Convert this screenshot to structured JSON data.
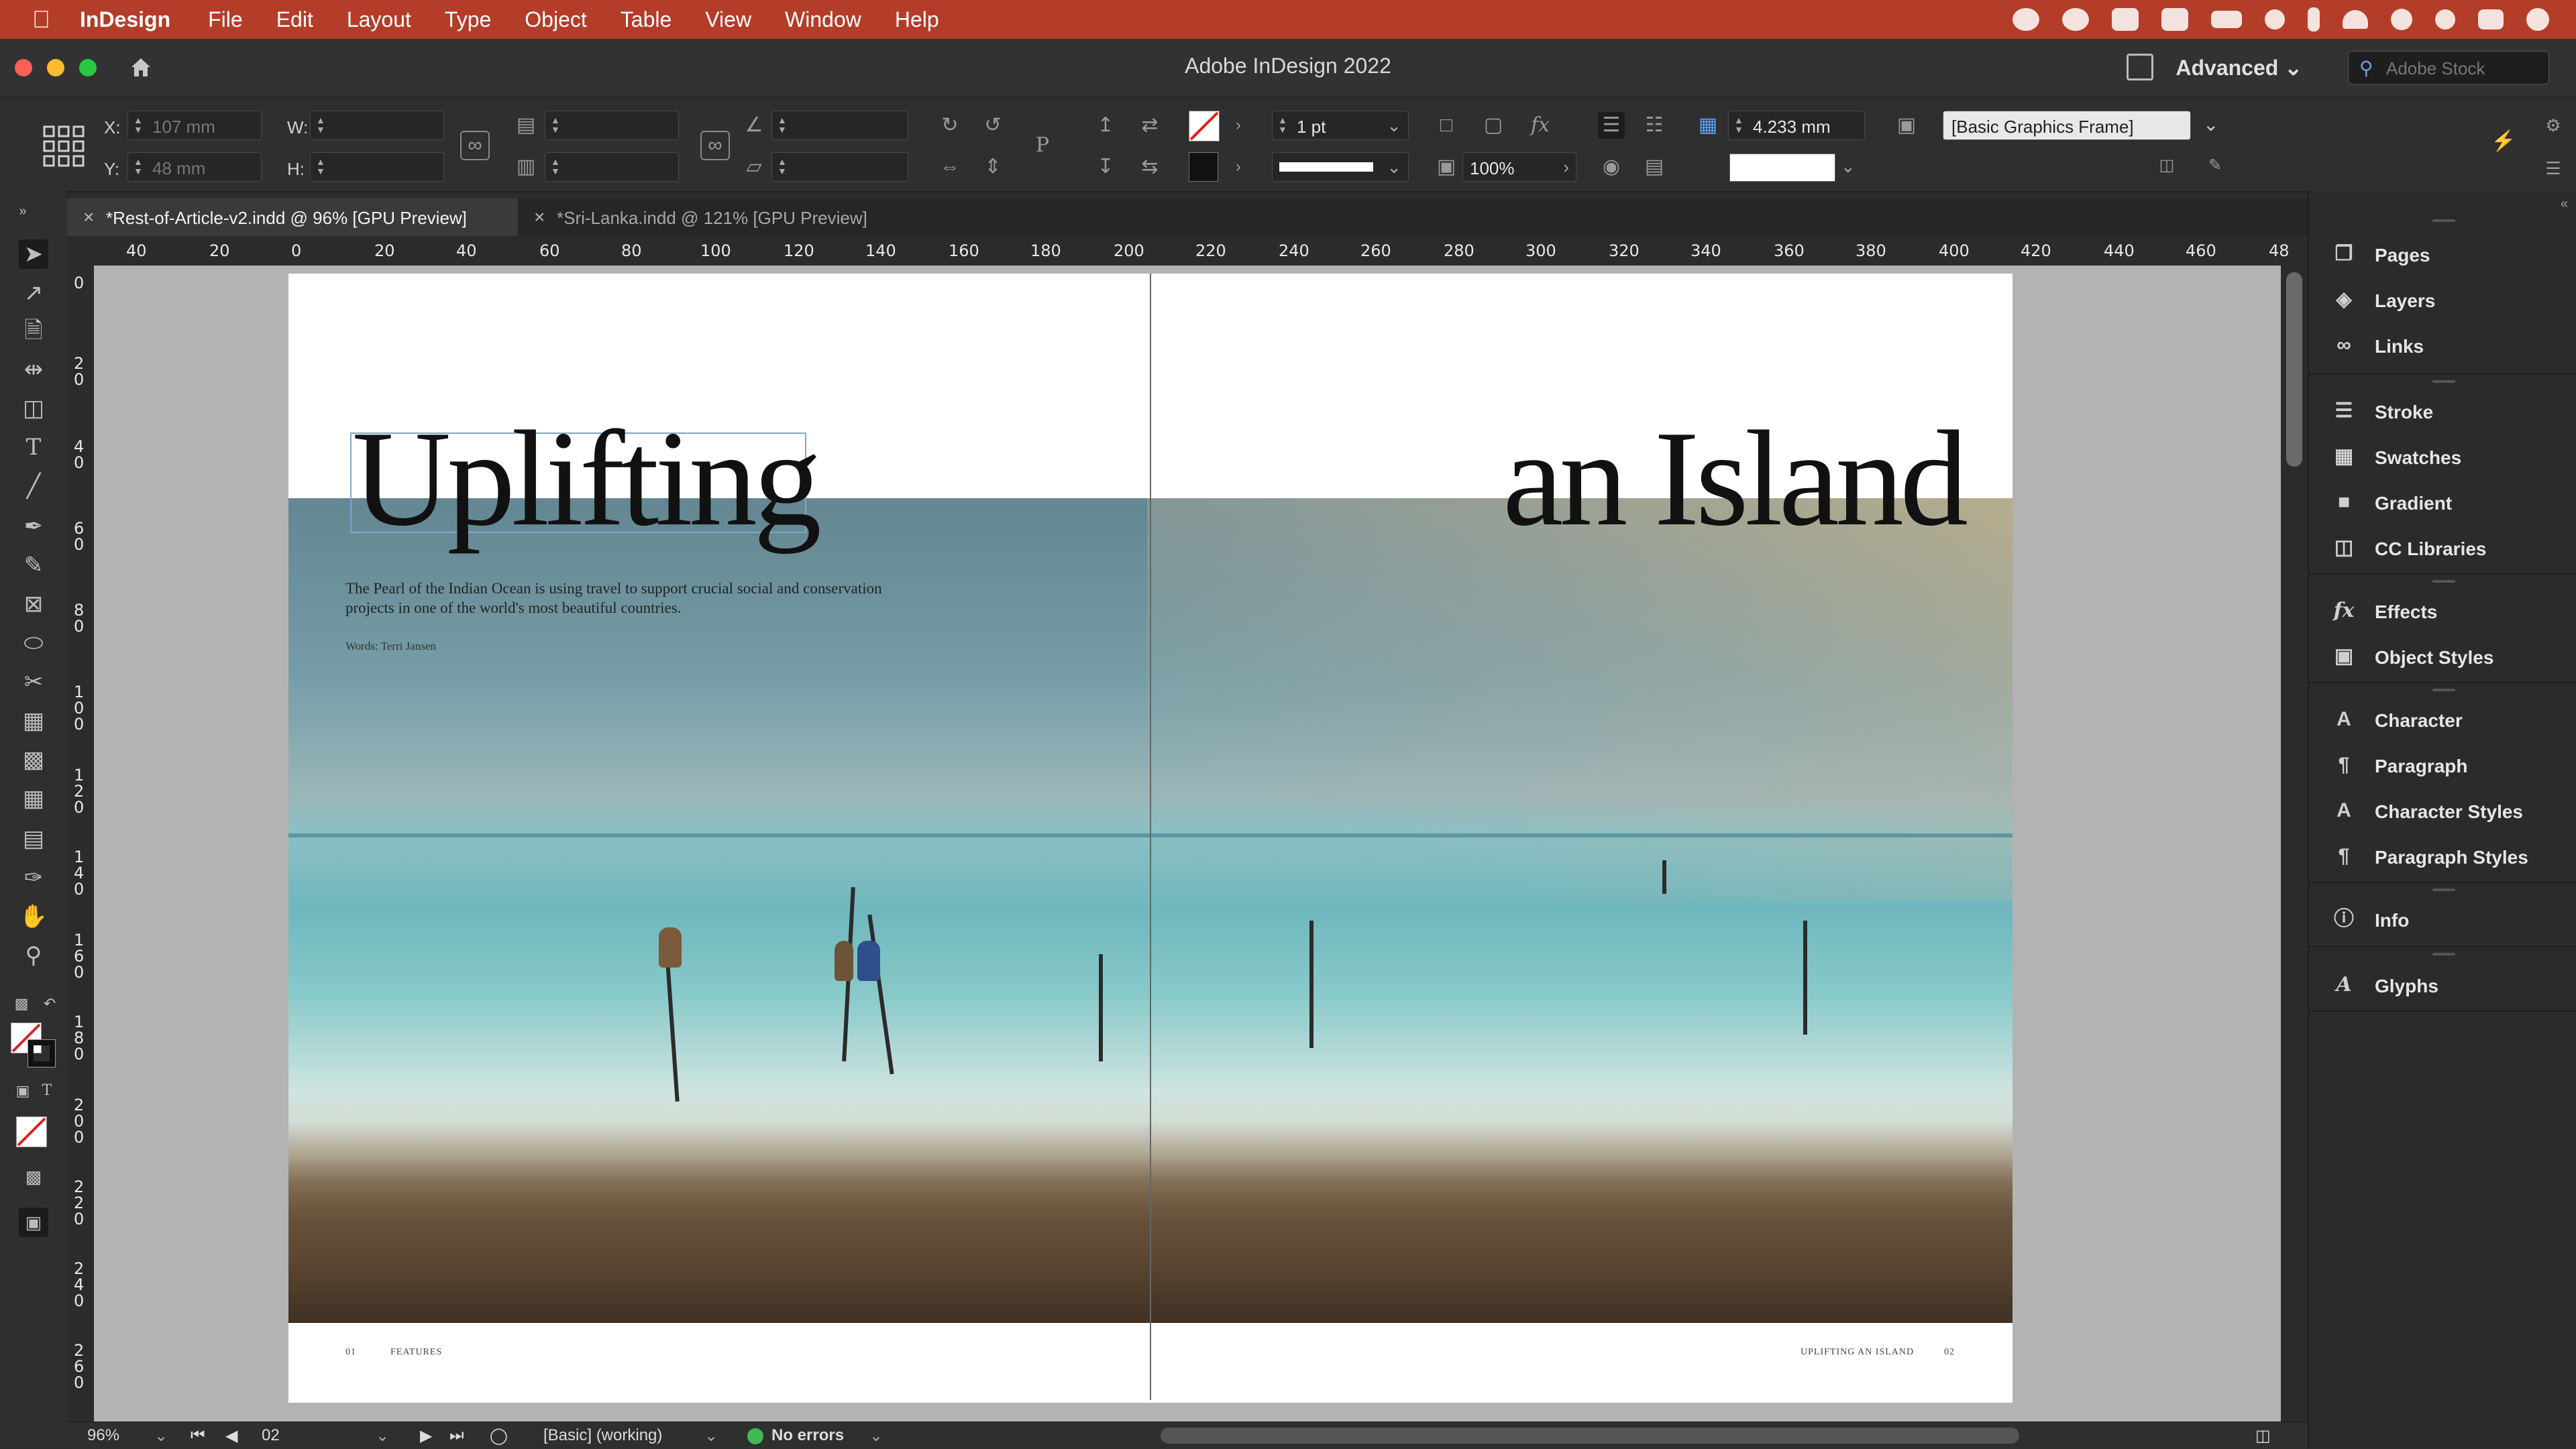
{
  "menubar": {
    "app_name": "InDesign",
    "menus": [
      "File",
      "Edit",
      "Layout",
      "Type",
      "Object",
      "Table",
      "View",
      "Window",
      "Help"
    ],
    "bg_color": "#b33d28",
    "tray_icons": [
      "creative-cloud-icon",
      "sync-icon",
      "dropbox-icon",
      "acrobat-icon",
      "battery-icon",
      "moon-icon",
      "bluetooth-icon",
      "wifi-icon",
      "user-icon",
      "search-icon",
      "control-center-icon",
      "siri-icon"
    ]
  },
  "window": {
    "title": "Adobe InDesign 2022",
    "workspace": "Advanced",
    "stock_search_placeholder": "Adobe Stock"
  },
  "controls": {
    "x_label": "X:",
    "x_value": "107 mm",
    "y_label": "Y:",
    "y_value": "48 mm",
    "w_label": "W:",
    "h_label": "H:",
    "stroke_weight": "1 pt",
    "opacity": "100%",
    "offset": "4.233 mm",
    "object_style": "[Basic Graphics Frame]"
  },
  "tabs": [
    {
      "label": "*Rest-of-Article-v2.indd @ 96% [GPU Preview]",
      "active": true
    },
    {
      "label": "*Sri-Lanka.indd @ 121% [GPU Preview]",
      "active": false
    }
  ],
  "hruler_ticks": [
    "40",
    "20",
    "0",
    "20",
    "40",
    "60",
    "80",
    "100",
    "120",
    "140",
    "160",
    "180",
    "200",
    "220",
    "240",
    "260",
    "280",
    "300",
    "320",
    "340",
    "360",
    "380",
    "400",
    "420",
    "440",
    "460",
    "48"
  ],
  "vruler_ticks": [
    "0",
    "2\n0",
    "4\n0",
    "6\n0",
    "8\n0",
    "1\n0\n0",
    "1\n2\n0",
    "1\n4\n0",
    "1\n6\n0",
    "1\n8\n0",
    "2\n0\n0",
    "2\n2\n0",
    "2\n4\n0",
    "2\n6\n0"
  ],
  "spread": {
    "headline_left": "Uplifting",
    "headline_right": "an Island",
    "deck": "The Pearl of the Indian Ocean is using travel to support crucial social and conservation projects in one of the world's most beautiful countries.",
    "byline": "Words: Terri Jansen",
    "folio_left_num": "01",
    "folio_left_section": "FEATURES",
    "folio_right_title": "UPLIFTING AN ISLAND",
    "folio_right_num": "02"
  },
  "panels": {
    "group1": [
      "Pages",
      "Layers",
      "Links"
    ],
    "group2": [
      "Stroke",
      "Swatches",
      "Gradient",
      "CC Libraries"
    ],
    "group3": [
      "Effects",
      "Object Styles"
    ],
    "group4": [
      "Character",
      "Paragraph",
      "Character Styles",
      "Paragraph Styles"
    ],
    "group5": [
      "Info"
    ],
    "group6": [
      "Glyphs"
    ]
  },
  "status": {
    "zoom": "96%",
    "page": "02",
    "preflight_profile": "[Basic] (working)",
    "errors": "No errors"
  },
  "colors": {
    "accent_selection": "#7da6cf",
    "no_errors_dot": "#3fb950"
  }
}
